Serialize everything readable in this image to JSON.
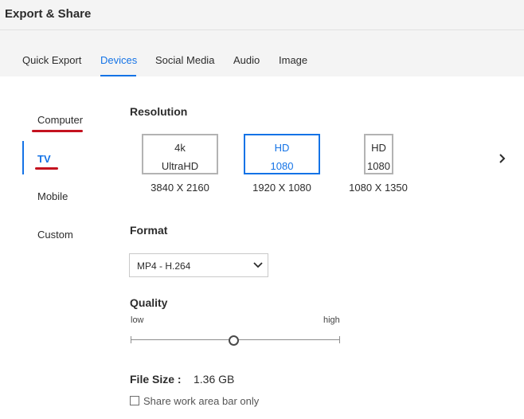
{
  "app": {
    "title": "Export & Share"
  },
  "tabs": [
    {
      "label": "Quick Export",
      "active": false
    },
    {
      "label": "Devices",
      "active": true
    },
    {
      "label": "Social Media",
      "active": false
    },
    {
      "label": "Audio",
      "active": false
    },
    {
      "label": "Image",
      "active": false
    }
  ],
  "sidebar": {
    "items": [
      {
        "label": "Computer",
        "active": false
      },
      {
        "label": "TV",
        "active": true
      },
      {
        "label": "Mobile",
        "active": false
      },
      {
        "label": "Custom",
        "active": false
      }
    ]
  },
  "resolution": {
    "heading": "Resolution",
    "options": [
      {
        "line1": "4k",
        "line2": "UltraHD",
        "caption": "3840 X 2160",
        "selected": false
      },
      {
        "line1": "HD",
        "line2": "1080",
        "caption": "1920 X 1080",
        "selected": true
      },
      {
        "line1": "HD",
        "line2": "1080",
        "caption": "1080 X 1350",
        "selected": false
      }
    ],
    "next_icon": "chevron-right-icon"
  },
  "format": {
    "heading": "Format",
    "selected": "MP4 - H.264",
    "dropdown_icon": "chevron-down-icon"
  },
  "quality": {
    "heading": "Quality",
    "min_label": "low",
    "max_label": "high",
    "value_fraction": 0.49
  },
  "file_size": {
    "label": "File Size :",
    "value": "1.36 GB"
  },
  "share_option": {
    "label": "Share work area bar only",
    "checked": false
  },
  "colors": {
    "accent": "#1473e6",
    "annotation": "#c4121f",
    "panel_bg": "#ffffff",
    "chrome_bg": "#f4f4f4"
  }
}
